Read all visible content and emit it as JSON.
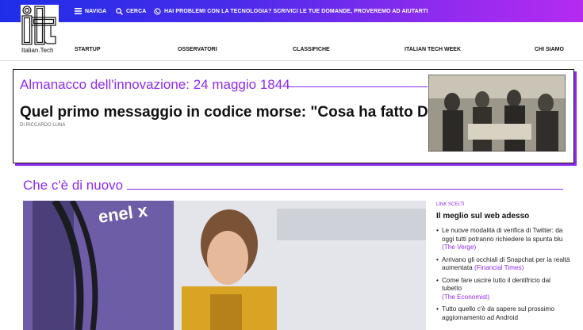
{
  "topbar": {
    "navigate_label": "NAVIGA",
    "search_label": "CERCA",
    "whatsapp_text": "HAI PROBLEMI CON LA TECNOLOGIA? SCRIVICI LE TUE DOMANDE, PROVEREMO AD AIUTARTI"
  },
  "logo": {
    "text": "Italian.Tech"
  },
  "nav": [
    "STARTUP",
    "OSSERVATORI",
    "CLASSIFICHE",
    "ITALIAN TECH WEEK",
    "CHI SIAMO"
  ],
  "feature": {
    "kicker": "Almanacco dell'innovazione: 24 maggio 1844",
    "headline": "Quel primo messaggio in codice morse: \"Cosa ha fatto Dio?\"",
    "byline": "DI RICCARDO LUNA"
  },
  "section": {
    "title": "Che c'è di nuovo"
  },
  "hero": {
    "brand_text": "enel x"
  },
  "sidebar": {
    "kicker": "LINK SCELTI",
    "title": "Il meglio sul web adesso",
    "items": [
      {
        "text": "Le nuove modalità di verifica di Twitter: da oggi tutti potranno richiedere la spunta blu",
        "source": "(The Verge)"
      },
      {
        "text": "Arrivano gli occhiali di Snapchat per la realtà aumentata",
        "source": "(Financial Times)"
      },
      {
        "text": "Come fare uscire tutto il dentifricio dal tubetto",
        "source": "(The Economist)"
      },
      {
        "text": "Tutto quello c'è da sapere sul prossimo aggiornamento ad Android",
        "source": ""
      }
    ]
  },
  "colors": {
    "accent": "#8e2bee",
    "gradient_start": "#1e2ee8",
    "gradient_end": "#b52bf0"
  }
}
